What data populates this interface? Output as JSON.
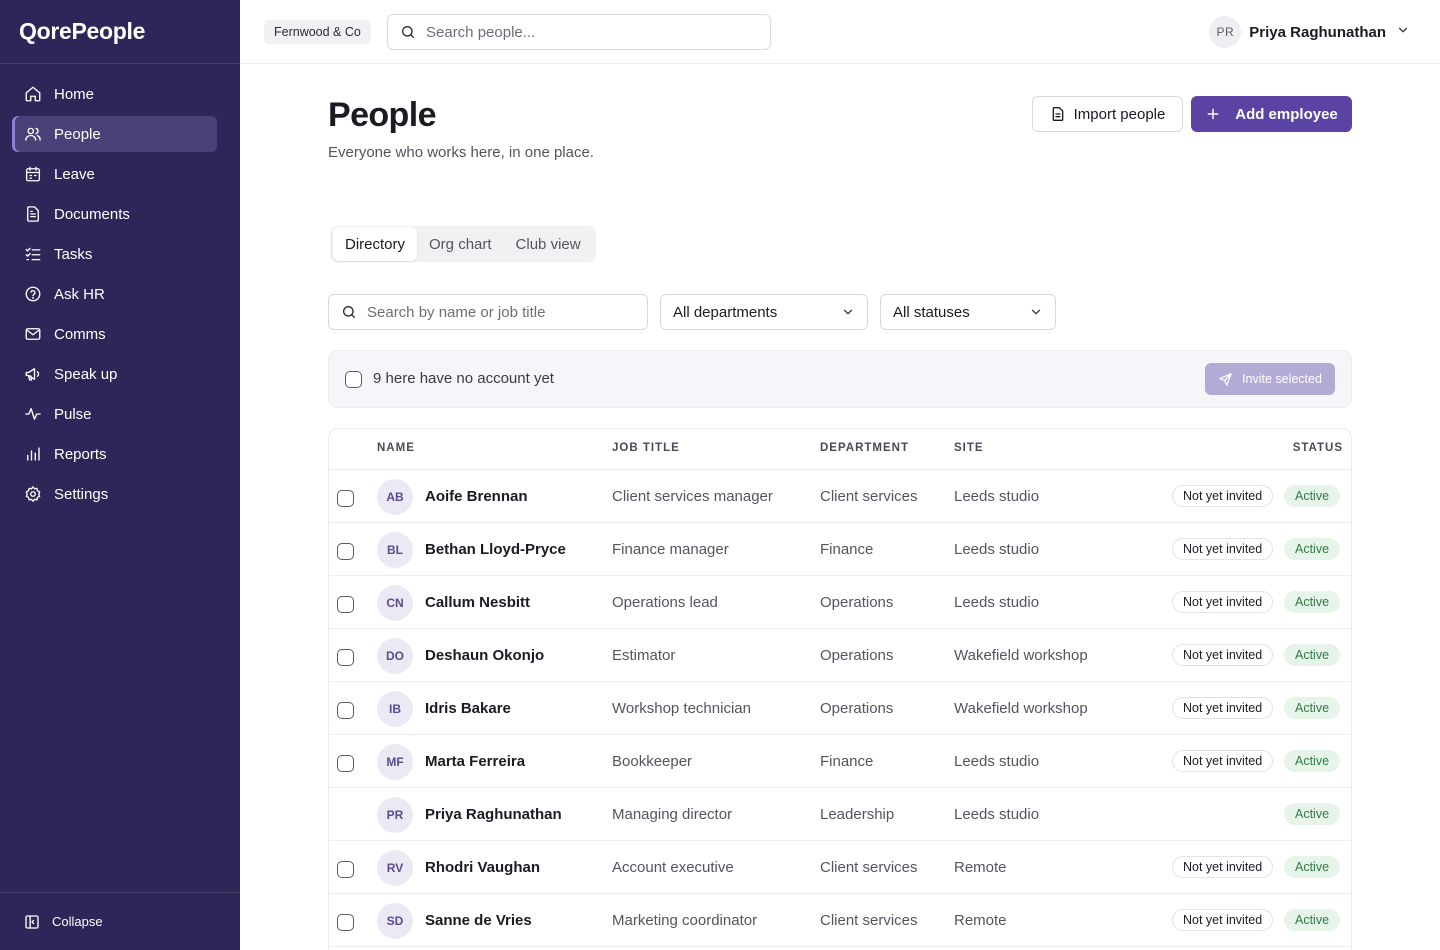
{
  "app": {
    "logo": "QorePeople",
    "org": "Fernwood & Co"
  },
  "search": {
    "placeholder": "Search people..."
  },
  "user": {
    "initials": "PR",
    "name": "Priya Raghunathan"
  },
  "sidebar": {
    "items": [
      {
        "label": "Home",
        "icon": "home-icon"
      },
      {
        "label": "People",
        "icon": "users-icon",
        "active": true
      },
      {
        "label": "Leave",
        "icon": "calendar-icon"
      },
      {
        "label": "Documents",
        "icon": "document-icon"
      },
      {
        "label": "Tasks",
        "icon": "tasks-icon"
      },
      {
        "label": "Ask HR",
        "icon": "help-icon"
      },
      {
        "label": "Comms",
        "icon": "mail-icon"
      },
      {
        "label": "Speak up",
        "icon": "megaphone-icon"
      },
      {
        "label": "Pulse",
        "icon": "pulse-icon"
      },
      {
        "label": "Reports",
        "icon": "chart-icon"
      },
      {
        "label": "Settings",
        "icon": "gear-icon"
      }
    ],
    "collapse_label": "Collapse"
  },
  "page": {
    "title": "People",
    "subtitle": "Everyone who works here, in one place.",
    "import_label": "Import people",
    "add_label": "Add employee"
  },
  "tabs": [
    "Directory",
    "Org chart",
    "Club view"
  ],
  "filters": {
    "search_placeholder": "Search by name or job title",
    "department": "All departments",
    "status": "All statuses"
  },
  "invite": {
    "text": "9 here have no account yet",
    "button": "Invite selected"
  },
  "table": {
    "headers": {
      "name": "NAME",
      "job": "JOB TITLE",
      "dept": "DEPARTMENT",
      "site": "SITE",
      "status": "STATUS"
    },
    "rows": [
      {
        "initials": "AB",
        "name": "Aoife Brennan",
        "job": "Client services manager",
        "dept": "Client services",
        "site": "Leeds studio",
        "invite": "Not yet invited",
        "status": "Active"
      },
      {
        "initials": "BL",
        "name": "Bethan Lloyd-Pryce",
        "job": "Finance manager",
        "dept": "Finance",
        "site": "Leeds studio",
        "invite": "Not yet invited",
        "status": "Active"
      },
      {
        "initials": "CN",
        "name": "Callum Nesbitt",
        "job": "Operations lead",
        "dept": "Operations",
        "site": "Leeds studio",
        "invite": "Not yet invited",
        "status": "Active"
      },
      {
        "initials": "DO",
        "name": "Deshaun Okonjo",
        "job": "Estimator",
        "dept": "Operations",
        "site": "Wakefield workshop",
        "invite": "Not yet invited",
        "status": "Active"
      },
      {
        "initials": "IB",
        "name": "Idris Bakare",
        "job": "Workshop technician",
        "dept": "Operations",
        "site": "Wakefield workshop",
        "invite": "Not yet invited",
        "status": "Active"
      },
      {
        "initials": "MF",
        "name": "Marta Ferreira",
        "job": "Bookkeeper",
        "dept": "Finance",
        "site": "Leeds studio",
        "invite": "Not yet invited",
        "status": "Active"
      },
      {
        "initials": "PR",
        "name": "Priya Raghunathan",
        "job": "Managing director",
        "dept": "Leadership",
        "site": "Leeds studio",
        "invite": "",
        "status": "Active"
      },
      {
        "initials": "RV",
        "name": "Rhodri Vaughan",
        "job": "Account executive",
        "dept": "Client services",
        "site": "Remote",
        "invite": "Not yet invited",
        "status": "Active"
      },
      {
        "initials": "SD",
        "name": "Sanne de Vries",
        "job": "Marketing coordinator",
        "dept": "Client services",
        "site": "Remote",
        "invite": "Not yet invited",
        "status": "Active"
      }
    ]
  },
  "colors": {
    "sidebar": "#2e2558",
    "accent": "#5b43a3",
    "active_badge_text": "#2f7a43",
    "active_badge_bg": "#e7f4ea"
  }
}
